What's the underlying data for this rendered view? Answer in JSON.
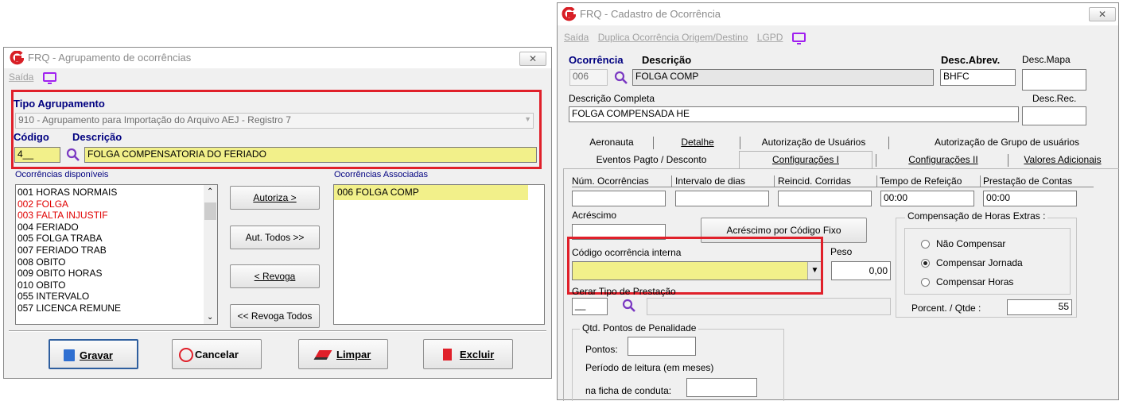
{
  "left_window": {
    "title": "FRQ - Agrupamento de ocorrências",
    "close_label": "✕",
    "menu": {
      "saida": "Saída"
    },
    "tipo_agrupamento_label": "Tipo Agrupamento",
    "tipo_agrupamento_value": "910 - Agrupamento para Importação do Arquivo AEJ - Registro 7",
    "codigo_label": "Código",
    "descricao_label": "Descrição",
    "codigo_value": "4__",
    "descricao_value": "FOLGA COMPENSATORIA DO FERIADO",
    "disponiveis_label": "Ocorrências disponíveis",
    "associadas_label": "Ocorrências Associadas",
    "disponiveis": [
      {
        "text": "001 HORAS NORMAIS",
        "color": "#000000"
      },
      {
        "text": "002 FOLGA",
        "color": "#e00000"
      },
      {
        "text": "003 FALTA INJUSTIF",
        "color": "#e00000"
      },
      {
        "text": "004 FERIADO",
        "color": "#000000"
      },
      {
        "text": "005 FOLGA TRABA",
        "color": "#000000"
      },
      {
        "text": "007 FERIADO TRAB",
        "color": "#000000"
      },
      {
        "text": "008 OBITO",
        "color": "#000000"
      },
      {
        "text": "009 OBITO HORAS",
        "color": "#000000"
      },
      {
        "text": "010 OBITO",
        "color": "#000000"
      },
      {
        "text": "055 INTERVALO",
        "color": "#000000"
      },
      {
        "text": "057 LICENCA REMUNE",
        "color": "#000000"
      }
    ],
    "associadas": [
      "006 FOLGA COMP"
    ],
    "buttons": {
      "autoriza": "Autoriza >",
      "aut_todos": "Aut. Todos >>",
      "revoga": "< Revoga",
      "revoga_todos": "<< Revoga Todos"
    },
    "footer": {
      "gravar": "Gravar",
      "cancelar": "Cancelar",
      "limpar": "Limpar",
      "excluir": "Excluir"
    }
  },
  "right_window": {
    "title": "FRQ - Cadastro de Ocorrência",
    "close_label": "✕",
    "menu": {
      "saida": "Saída",
      "duplica": "Duplica Ocorrência Origem/Destino",
      "lgpd": "LGPD"
    },
    "ocorrencia_label": "Ocorrência",
    "descricao_label": "Descrição",
    "desc_abrev_label": "Desc.Abrev.",
    "desc_mapa_label": "Desc.Mapa",
    "ocorrencia_value": "006",
    "descricao_value": "FOLGA COMP",
    "desc_abrev_value": "BHFC",
    "desc_mapa_value": "",
    "descricao_completa_label": "Descrição Completa",
    "descricao_completa_value": "FOLGA COMPENSADA HE",
    "desc_rec_label": "Desc.Rec.",
    "desc_rec_value": "",
    "tabs_row1": [
      "Aeronauta",
      "Detalhe",
      "Autorização de Usuários",
      "Autorização de Grupo de usuários"
    ],
    "tabs_row2": [
      "Eventos Pagto / Desconto",
      "Configurações I",
      "Configurações II",
      "Valores Adicionais"
    ],
    "num_ocorrencias_label": "Núm. Ocorrências",
    "intervalo_dias_label": "Intervalo de dias",
    "reincid_label": "Reincid. Corridas",
    "tempo_refeicao_label": "Tempo de Refeição",
    "prestacao_label": "Prestação de Contas",
    "tempo_refeicao_value": "00:00",
    "prestacao_value": "00:00",
    "acrescimo_label": "Acréscimo",
    "acrescimo_fixo_button": "Acréscimo por Código Fixo",
    "compensacao_title": "Compensação de Horas Extras :",
    "radio_nao": "Não Compensar",
    "radio_jornada": "Compensar Jornada",
    "radio_horas": "Compensar Horas",
    "porcent_label": "Porcent. / Qtde :",
    "porcent_value": "55",
    "codigo_interna_label": "Código ocorrência interna",
    "peso_label": "Peso",
    "peso_value": "0,00",
    "gerar_tipo_label": "Gerar Tipo de Prestação",
    "gerar_tipo_code": "__",
    "pontos_group_title": "Qtd. Pontos de Penalidade",
    "pontos_label": "Pontos:",
    "periodo_label": "Período de leitura (em meses)",
    "ficha_label": "na ficha de conduta:"
  },
  "colors": {
    "highlight_yellow": "#f2f08a",
    "red_outline": "#e0202a",
    "label_blue": "#000080",
    "brand_red": "#d81f26",
    "monitor_purple": "#a020f0"
  }
}
